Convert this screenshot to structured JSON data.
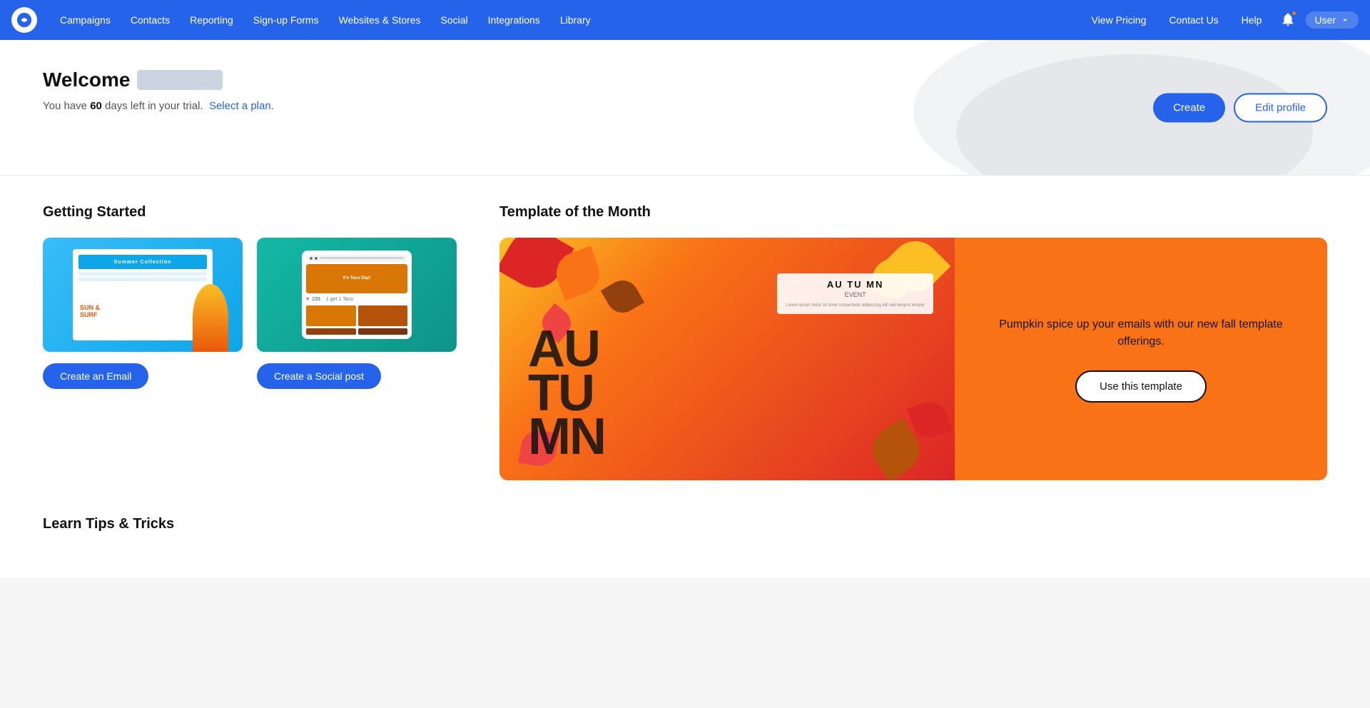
{
  "navbar": {
    "logo_alt": "Constant Contact logo",
    "items_left": [
      {
        "label": "Campaigns",
        "id": "campaigns"
      },
      {
        "label": "Contacts",
        "id": "contacts"
      },
      {
        "label": "Reporting",
        "id": "reporting"
      },
      {
        "label": "Sign-up Forms",
        "id": "signup-forms"
      },
      {
        "label": "Websites & Stores",
        "id": "websites-stores"
      },
      {
        "label": "Social",
        "id": "social"
      },
      {
        "label": "Integrations",
        "id": "integrations"
      },
      {
        "label": "Library",
        "id": "library"
      }
    ],
    "items_right": [
      {
        "label": "View Pricing",
        "id": "view-pricing"
      },
      {
        "label": "Contact Us",
        "id": "contact-us"
      },
      {
        "label": "Help",
        "id": "help"
      }
    ],
    "user_label": "User"
  },
  "hero": {
    "welcome_text": "Welcome",
    "trial_text": "You have ",
    "trial_days": "60",
    "trial_suffix": " days left in your trial.",
    "select_plan": "Select a plan.",
    "create_btn": "Create",
    "edit_profile_btn": "Edit profile"
  },
  "getting_started": {
    "title": "Getting Started",
    "cards": [
      {
        "id": "create-email",
        "btn_label": "Create an Email",
        "img_alt": "Email campaign preview"
      },
      {
        "id": "create-social",
        "btn_label": "Create a Social post",
        "img_alt": "Social post preview"
      }
    ]
  },
  "template_month": {
    "title": "Template of the Month",
    "description": "Pumpkin spice up your emails with our new fall template offerings.",
    "btn_label": "Use this template",
    "autumn_word": "AUTUMN",
    "event_label": "AU TU MN",
    "event_sub": "EVENT"
  },
  "learn_tips": {
    "title": "Learn Tips & Tricks"
  }
}
